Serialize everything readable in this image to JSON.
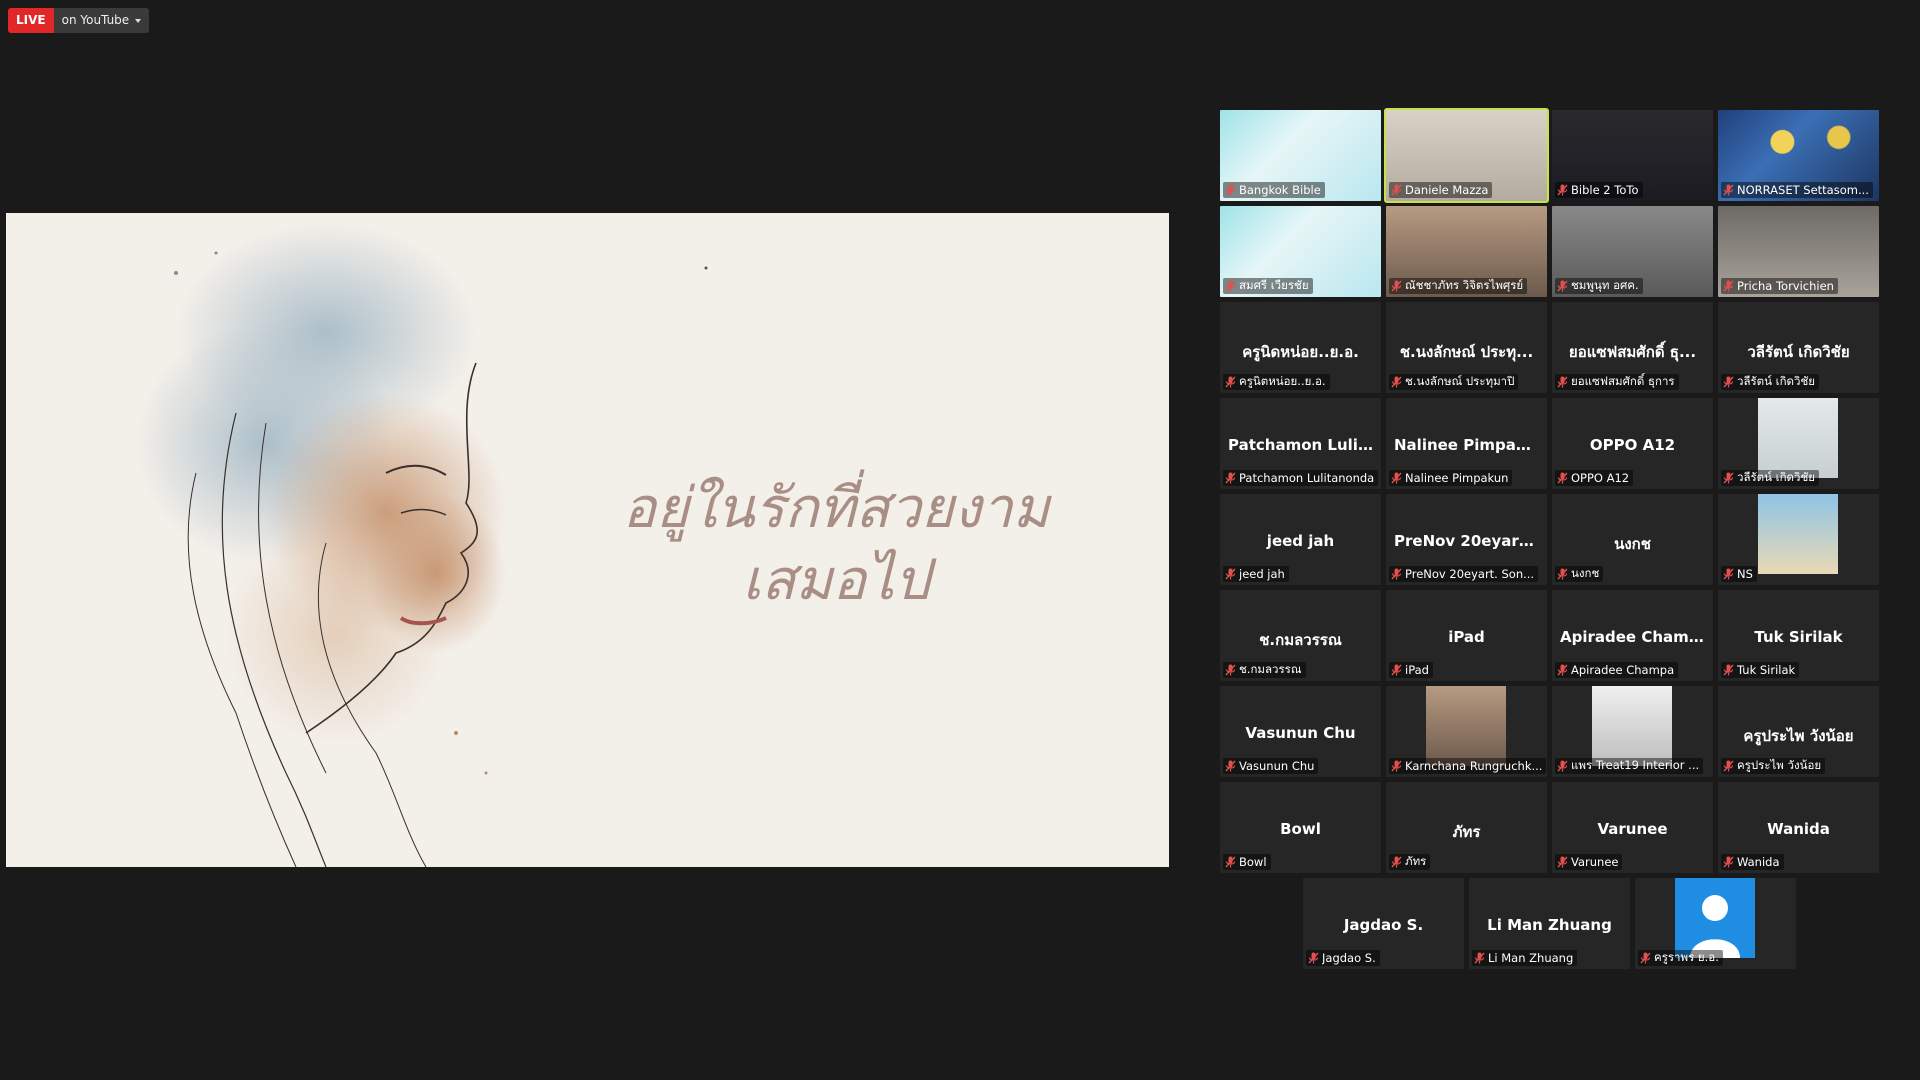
{
  "top": {
    "live_badge": "LIVE",
    "youtube": "on YouTube"
  },
  "shared_screen": {
    "lyric_line1": "อยู่ในรักที่สวยงาม",
    "lyric_line2": "เสมอไป"
  },
  "participants": [
    {
      "name": "Bangkok Bible",
      "video": true,
      "bg": "bg-poster",
      "active": false
    },
    {
      "name": "Daniele Mazza",
      "video": true,
      "bg": "bg-room",
      "active": true
    },
    {
      "name": "Bible 2 ToTo",
      "video": true,
      "bg": "bg-dark",
      "active": false
    },
    {
      "name": "NORRASET Settasom...",
      "video": true,
      "bg": "bg-night",
      "active": false
    },
    {
      "name": "สมศรี เวียรชัย",
      "video": true,
      "bg": "bg-poster",
      "active": false
    },
    {
      "name": "ณัชชาภัทร วิจิตรไพศุรย์",
      "video": true,
      "bg": "bg-photo1",
      "active": false
    },
    {
      "name": "ชมพูนุท อศค.",
      "video": true,
      "bg": "bg-grey",
      "active": false
    },
    {
      "name": "Pricha Torvichien",
      "video": true,
      "bg": "bg-office",
      "active": false
    },
    {
      "name": "ครูนิตหน่อย..ย.อ.",
      "title": "ครูนิดหน่อย..ย.อ.",
      "video": false
    },
    {
      "name": "ช.นงลักษณ์ ประทุมาปิ",
      "title": "ช.นงลักษณ์ ประทุ...",
      "video": false
    },
    {
      "name": "ยอแซฟสมศักดิ์ ธุการ",
      "title": "ยอแซฟสมศักดิ์ ธุ...",
      "video": false
    },
    {
      "name": "วลีรัตน์ เกิดวิชัย",
      "title": "วลีรัตน์ เกิดวิชัย",
      "video": false
    },
    {
      "name": "Patchamon Lulitanonda",
      "title": "Patchamon Lulit...",
      "video": false
    },
    {
      "name": "Nalinee  Pimpakun",
      "title": "Nalinee  Pimpak...",
      "video": false
    },
    {
      "name": "OPPO A12",
      "title": "OPPO A12",
      "video": false
    },
    {
      "name": "วลีรัตน์ เกิดวิชัย",
      "video": true,
      "bg": "bg-light",
      "small": true,
      "active": false
    },
    {
      "name": "jeed jah",
      "title": "jeed jah",
      "video": false
    },
    {
      "name": "PreNov 20eyart. Son...",
      "title": "PreNov 20eyart....",
      "video": false
    },
    {
      "name": "นงกช",
      "title": "นงกช",
      "video": false
    },
    {
      "name": "NS",
      "video": true,
      "bg": "bg-sun",
      "small": true,
      "active": false
    },
    {
      "name": "ช.กมลวรรณ",
      "title": "ช.กมลวรรณ",
      "video": false
    },
    {
      "name": "iPad",
      "title": "iPad",
      "video": false
    },
    {
      "name": "Apiradee Champa",
      "title": "Apiradee Champa",
      "video": false
    },
    {
      "name": "Tuk Sirilak",
      "title": "Tuk Sirilak",
      "video": false
    },
    {
      "name": "Vasunun Chu",
      "title": "Vasunun Chu",
      "video": false
    },
    {
      "name": "Karnchana Rungruchk...",
      "video": true,
      "bg": "bg-photo1",
      "small": true,
      "active": false
    },
    {
      "name": "แพร Treat19 Interior ...",
      "video": true,
      "bg": "bg-photo2",
      "small": true,
      "active": false
    },
    {
      "name": "ครูประไพ  วังน้อย",
      "title": "ครูประไพ  วังน้อย",
      "video": false
    },
    {
      "name": "Bowl",
      "title": "Bowl",
      "video": false
    },
    {
      "name": "ภัทร",
      "title": "ภัทร",
      "video": false
    },
    {
      "name": "Varunee",
      "title": "Varunee",
      "video": false
    },
    {
      "name": "Wanida",
      "title": "Wanida",
      "video": false
    },
    {
      "name": "Jagdao S.",
      "title": "Jagdao S.",
      "video": false
    },
    {
      "name": "Li Man Zhuang",
      "title": "Li Man Zhuang",
      "video": false
    },
    {
      "name": "ครูราพร ย.อ.",
      "video": true,
      "bg": "avatar-blue",
      "avatar": true,
      "small": true,
      "active": false
    }
  ],
  "colors": {
    "live": "#e02828",
    "active_speaker": "#c8e34a",
    "muted": "#e05050"
  }
}
